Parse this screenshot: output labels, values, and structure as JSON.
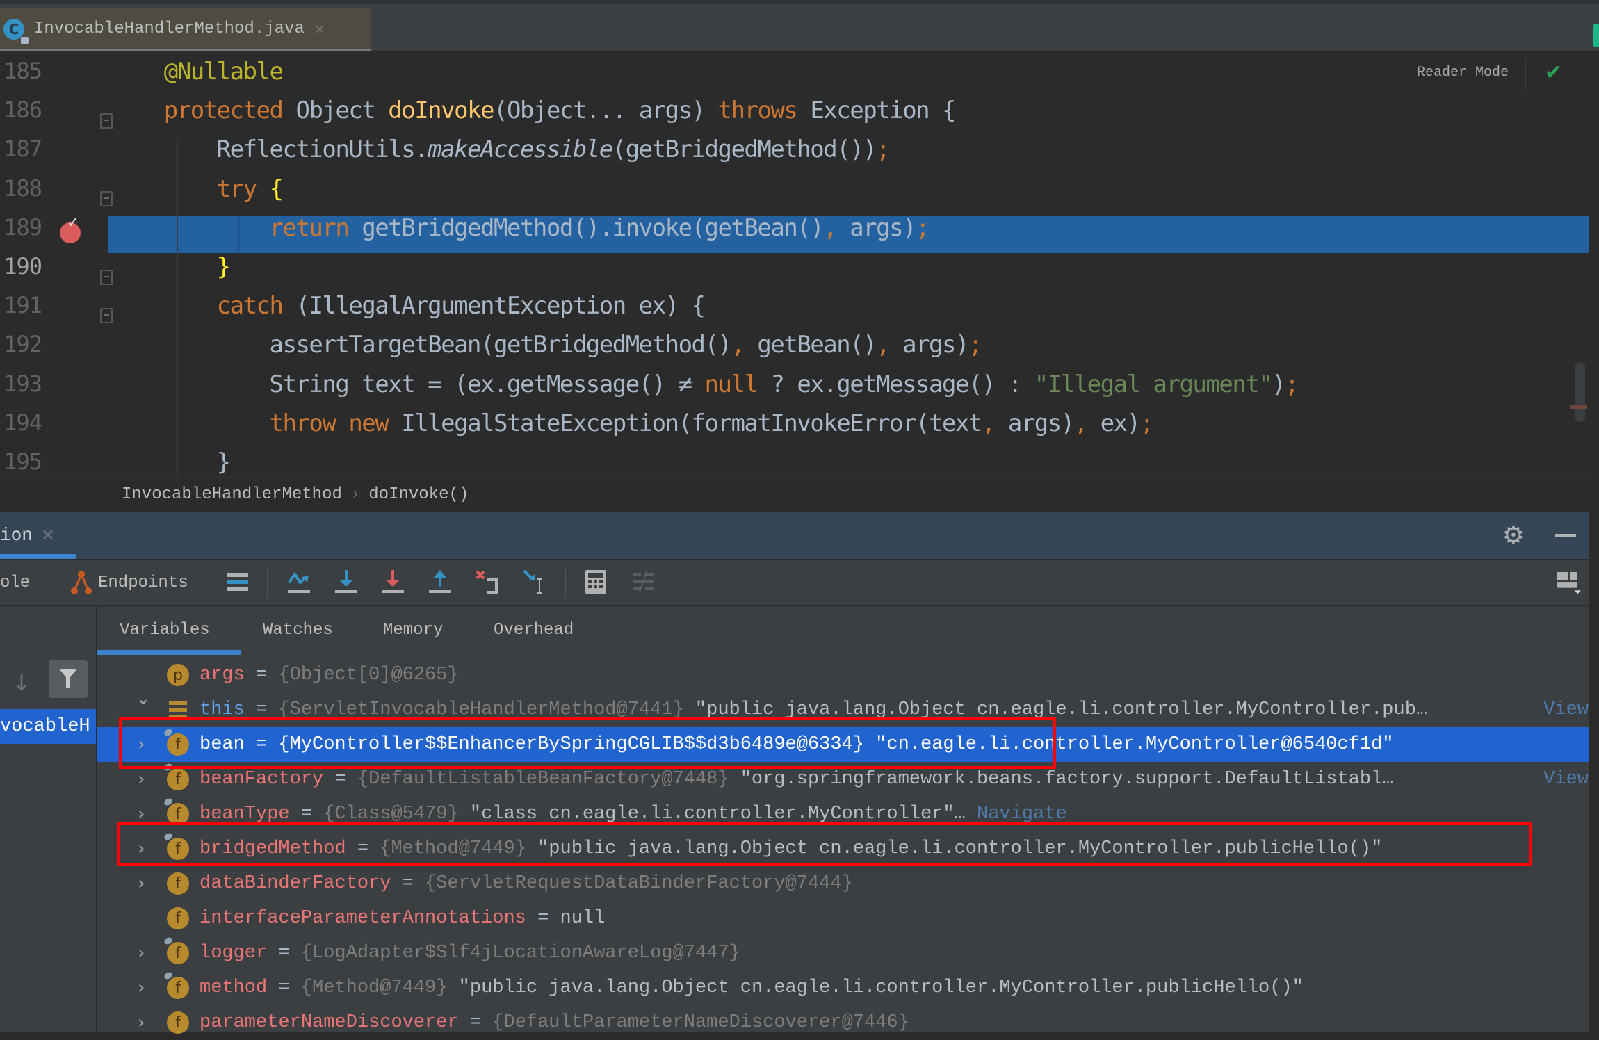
{
  "tab": {
    "filename": "InvocableHandlerMethod.java",
    "icon": "class-icon",
    "close": "×"
  },
  "editor": {
    "reader_mode": "Reader Mode",
    "lines": [
      {
        "num": "185",
        "tokens": [
          {
            "t": "        "
          },
          {
            "t": "@Nullable",
            "c": "ann"
          }
        ]
      },
      {
        "num": "186",
        "tokens": [
          {
            "t": "        "
          },
          {
            "t": "protected",
            "c": "kw"
          },
          {
            "t": " Object "
          },
          {
            "t": "doInvoke",
            "c": "fn"
          },
          {
            "t": "(Object... args) "
          },
          {
            "t": "throws",
            "c": "kw"
          },
          {
            "t": " Exception {"
          }
        ]
      },
      {
        "num": "187",
        "tokens": [
          {
            "t": "            ReflectionUtils."
          },
          {
            "t": "makeAccessible",
            "c": "it"
          },
          {
            "t": "(getBridgedMethod())"
          },
          {
            "t": ";",
            "c": "kw"
          }
        ]
      },
      {
        "num": "188",
        "tokens": [
          {
            "t": "            "
          },
          {
            "t": "try",
            "c": "kw"
          },
          {
            "t": " "
          },
          {
            "t": "{",
            "c": "brace"
          }
        ]
      },
      {
        "num": "189",
        "tokens": [
          {
            "t": "                "
          },
          {
            "t": "return",
            "c": "kw"
          },
          {
            "t": " getBridgedMethod().invoke(getBean()"
          },
          {
            "t": ",",
            "c": "kw"
          },
          {
            "t": " args)"
          },
          {
            "t": ";",
            "c": "kw"
          }
        ]
      },
      {
        "num": "190",
        "tokens": [
          {
            "t": "            "
          },
          {
            "t": "}",
            "c": "brace"
          }
        ]
      },
      {
        "num": "191",
        "tokens": [
          {
            "t": "            "
          },
          {
            "t": "catch",
            "c": "kw"
          },
          {
            "t": " (IllegalArgumentException ex) {"
          }
        ]
      },
      {
        "num": "192",
        "tokens": [
          {
            "t": "                assertTargetBean(getBridgedMethod()"
          },
          {
            "t": ",",
            "c": "kw"
          },
          {
            "t": " getBean()"
          },
          {
            "t": ",",
            "c": "kw"
          },
          {
            "t": " args)"
          },
          {
            "t": ";",
            "c": "kw"
          }
        ]
      },
      {
        "num": "193",
        "tokens": [
          {
            "t": "                String text = (ex.getMessage() ≠ "
          },
          {
            "t": "null",
            "c": "kw"
          },
          {
            "t": " ? ex.getMessage() : "
          },
          {
            "t": "\"Illegal argument\"",
            "c": "str"
          },
          {
            "t": ")"
          },
          {
            "t": ";",
            "c": "kw"
          }
        ]
      },
      {
        "num": "194",
        "tokens": [
          {
            "t": "                "
          },
          {
            "t": "throw new",
            "c": "kw"
          },
          {
            "t": " IllegalStateException(formatInvokeError(text"
          },
          {
            "t": ",",
            "c": "kw"
          },
          {
            "t": " args)"
          },
          {
            "t": ",",
            "c": "kw"
          },
          {
            "t": " ex)"
          },
          {
            "t": ";",
            "c": "kw"
          }
        ]
      },
      {
        "num": "195",
        "tokens": [
          {
            "t": "            }"
          }
        ]
      }
    ],
    "current_line": "189"
  },
  "breadcrumb": {
    "class": "InvocableHandlerMethod",
    "method": "doInvoke()"
  },
  "debug": {
    "session_tab": "ion",
    "toolbar": {
      "console_label": "ole",
      "endpoints_label": "Endpoints"
    },
    "var_tabs": [
      "Variables",
      "Watches",
      "Memory",
      "Overhead"
    ],
    "frame_selected": "vocableH",
    "variables": [
      {
        "badge": "p",
        "name": "args",
        "type": "{Object[0]@6265}",
        "value": "",
        "expand": "",
        "link": ""
      },
      {
        "badge": "this",
        "name": "this",
        "type": "{ServletInvocableHandlerMethod@7441}",
        "value": "\"public java.lang.Object cn.eagle.li.controller.MyController.pub…",
        "expand": "v",
        "link": "View"
      },
      {
        "badge": "f",
        "name": "bean",
        "type": "{MyController$$EnhancerBySpringCGLIB$$d3b6489e@6334}",
        "value": "\"cn.eagle.li.controller.MyController@6540cf1d\"",
        "expand": ">",
        "link": ""
      },
      {
        "badge": "f",
        "name": "beanFactory",
        "type": "{DefaultListableBeanFactory@7448}",
        "value": "\"org.springframework.beans.factory.support.DefaultListabl…",
        "expand": ">",
        "link": "View"
      },
      {
        "badge": "f",
        "name": "beanType",
        "type": "{Class@5479}",
        "value": "\"class cn.eagle.li.controller.MyController\"…",
        "expand": ">",
        "link": "Navigate"
      },
      {
        "badge": "f",
        "name": "bridgedMethod",
        "type": "{Method@7449}",
        "value": "\"public java.lang.Object cn.eagle.li.controller.MyController.publicHello()\"",
        "expand": ">",
        "link": ""
      },
      {
        "badge": "f",
        "name": "dataBinderFactory",
        "type": "{ServletRequestDataBinderFactory@7444}",
        "value": "",
        "expand": ">",
        "link": ""
      },
      {
        "badge": "f",
        "name": "interfaceParameterAnnotations",
        "type": "",
        "value": "null",
        "expand": "",
        "link": ""
      },
      {
        "badge": "f",
        "name": "logger",
        "type": "{LogAdapter$Slf4jLocationAwareLog@7447}",
        "value": "",
        "expand": ">",
        "link": ""
      },
      {
        "badge": "f",
        "name": "method",
        "type": "{Method@7449}",
        "value": "\"public java.lang.Object cn.eagle.li.controller.MyController.publicHello()\"",
        "expand": ">",
        "link": ""
      },
      {
        "badge": "f",
        "name": "parameterNameDiscoverer",
        "type": "{DefaultParameterNameDiscoverer@7446}",
        "value": "",
        "expand": ">",
        "link": ""
      }
    ],
    "selected_variable": "bean",
    "highlighted_variables": [
      "bean",
      "bridgedMethod"
    ]
  }
}
